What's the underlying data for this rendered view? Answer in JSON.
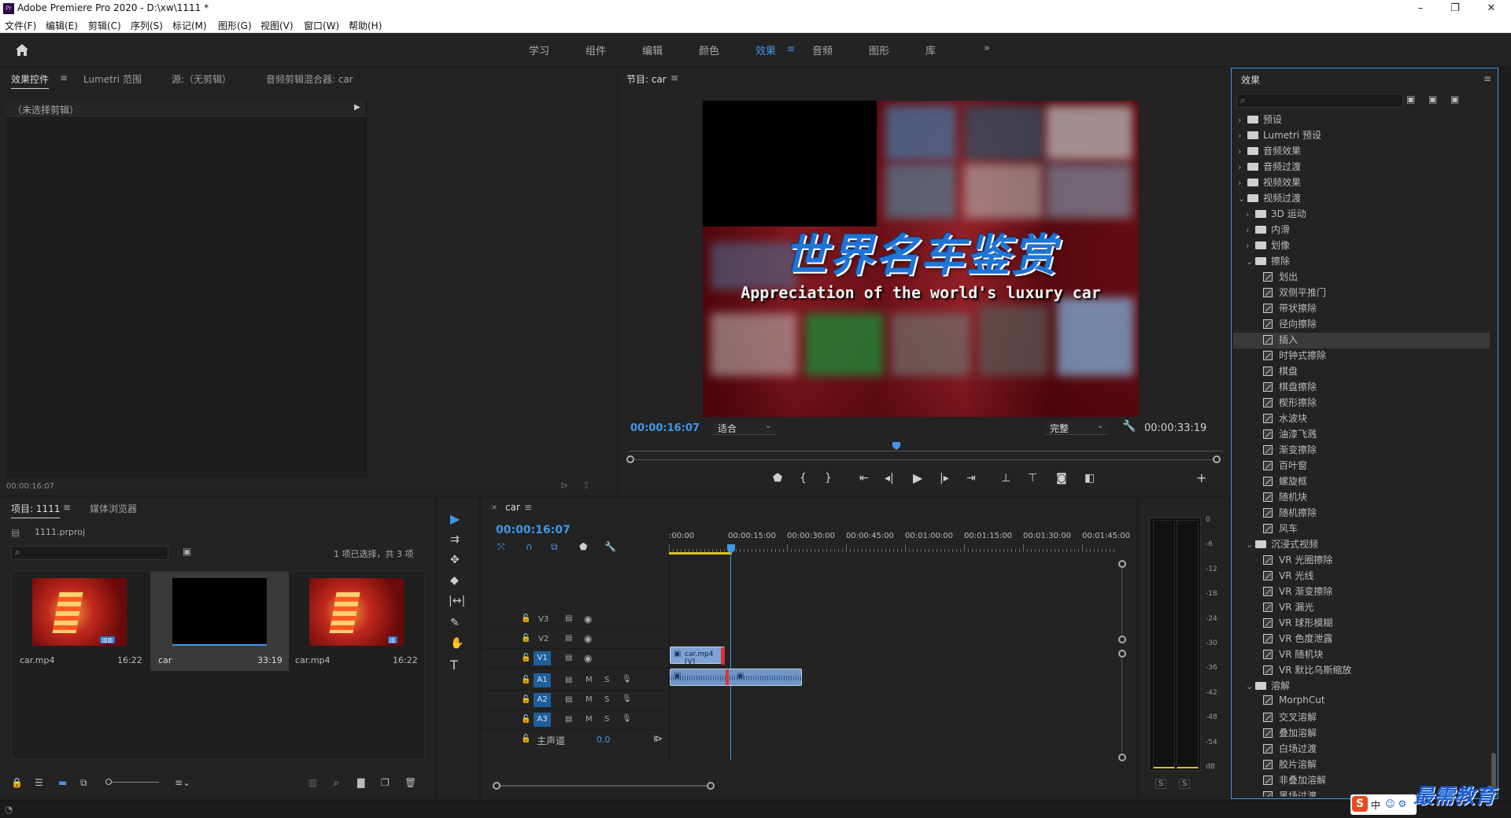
{
  "titlebar": {
    "title": "Adobe Premiere Pro 2020 - D:\\xw\\1111 *",
    "minimize": "–",
    "maximize": "❐",
    "close": "✕",
    "logo": "Pr"
  },
  "menubar": [
    "文件(F)",
    "编辑(E)",
    "剪辑(C)",
    "序列(S)",
    "标记(M)",
    "图形(G)",
    "视图(V)",
    "窗口(W)",
    "帮助(H)"
  ],
  "workspaces": {
    "items": [
      "学习",
      "组件",
      "编辑",
      "颜色",
      "效果",
      "音频",
      "图形",
      "库"
    ],
    "active": "效果",
    "more": "»"
  },
  "source_panel": {
    "tabs": [
      "效果控件",
      "Lumetri 范围",
      "源:（无剪辑）",
      "音频剪辑混合器: car"
    ],
    "active_tab": "效果控件",
    "no_clip": "（未选择剪辑）",
    "timecode": "00:00:16:07"
  },
  "program_monitor": {
    "tab": "节目: car",
    "title_cn": "世界名车鉴赏",
    "title_en": "Appreciation of the world's luxury car",
    "timecode_current": "00:00:16:07",
    "fit_label": "适合",
    "quality_label": "完整",
    "timecode_total": "00:00:33:19"
  },
  "project_panel": {
    "tabs": [
      "项目: 1111",
      "媒体浏览器"
    ],
    "project_file": "1111.prproj",
    "selection_info": "1 项已选择，共 3 项",
    "items": [
      {
        "name": "car.mp4",
        "duration": "16:22",
        "kind": "video"
      },
      {
        "name": "car",
        "duration": "33:19",
        "kind": "sequence"
      },
      {
        "name": "car.mp4",
        "duration": "16:22",
        "kind": "video"
      }
    ]
  },
  "timeline": {
    "sequence_name": "car",
    "timecode": "00:00:16:07",
    "ruler": [
      ":00:00",
      "00:00:15:00",
      "00:00:30:00",
      "00:00:45:00",
      "00:01:00:00",
      "00:01:15:00",
      "00:01:30:00",
      "00:01:45:00"
    ],
    "video_tracks": [
      "V3",
      "V2",
      "V1"
    ],
    "audio_tracks": [
      "A3",
      "A2",
      "A1"
    ],
    "master_label": "主声道",
    "master_value": "0.0",
    "clip_label": "car.mp4 [V]",
    "mute_label": "M",
    "solo_label": "S"
  },
  "meter": {
    "ticks": [
      "0",
      "-6",
      "-12",
      "-18",
      "-24",
      "-30",
      "-36",
      "-42",
      "-48",
      "-54",
      "dB"
    ],
    "solo_left": "S",
    "solo_right": "S"
  },
  "effects_panel": {
    "title": "效果",
    "tree": [
      {
        "label": "预设",
        "level": 0,
        "type": "folder",
        "open": false
      },
      {
        "label": "Lumetri 预设",
        "level": 0,
        "type": "folder",
        "open": false
      },
      {
        "label": "音频效果",
        "level": 0,
        "type": "folder",
        "open": false
      },
      {
        "label": "音频过渡",
        "level": 0,
        "type": "folder",
        "open": false
      },
      {
        "label": "视频效果",
        "level": 0,
        "type": "folder",
        "open": false
      },
      {
        "label": "视频过渡",
        "level": 0,
        "type": "folder",
        "open": true
      },
      {
        "label": "3D 运动",
        "level": 1,
        "type": "folder",
        "open": false
      },
      {
        "label": "内滑",
        "level": 1,
        "type": "folder",
        "open": false
      },
      {
        "label": "划像",
        "level": 1,
        "type": "folder",
        "open": false
      },
      {
        "label": "擦除",
        "level": 1,
        "type": "folder",
        "open": true
      },
      {
        "label": "划出",
        "level": 2,
        "type": "effect"
      },
      {
        "label": "双侧平推门",
        "level": 2,
        "type": "effect"
      },
      {
        "label": "带状擦除",
        "level": 2,
        "type": "effect"
      },
      {
        "label": "径向擦除",
        "level": 2,
        "type": "effect"
      },
      {
        "label": "插入",
        "level": 2,
        "type": "effect",
        "selected": true
      },
      {
        "label": "时钟式擦除",
        "level": 2,
        "type": "effect"
      },
      {
        "label": "棋盘",
        "level": 2,
        "type": "effect"
      },
      {
        "label": "棋盘擦除",
        "level": 2,
        "type": "effect"
      },
      {
        "label": "楔形擦除",
        "level": 2,
        "type": "effect"
      },
      {
        "label": "水波块",
        "level": 2,
        "type": "effect"
      },
      {
        "label": "油漆飞溅",
        "level": 2,
        "type": "effect"
      },
      {
        "label": "渐变擦除",
        "level": 2,
        "type": "effect"
      },
      {
        "label": "百叶窗",
        "level": 2,
        "type": "effect"
      },
      {
        "label": "螺旋框",
        "level": 2,
        "type": "effect"
      },
      {
        "label": "随机块",
        "level": 2,
        "type": "effect"
      },
      {
        "label": "随机擦除",
        "level": 2,
        "type": "effect"
      },
      {
        "label": "风车",
        "level": 2,
        "type": "effect"
      },
      {
        "label": "沉浸式视频",
        "level": 1,
        "type": "folder",
        "open": true
      },
      {
        "label": "VR 光圈擦除",
        "level": 2,
        "type": "effect"
      },
      {
        "label": "VR 光线",
        "level": 2,
        "type": "effect"
      },
      {
        "label": "VR 渐变擦除",
        "level": 2,
        "type": "effect"
      },
      {
        "label": "VR 漏光",
        "level": 2,
        "type": "effect"
      },
      {
        "label": "VR 球形模糊",
        "level": 2,
        "type": "effect"
      },
      {
        "label": "VR 色度泄露",
        "level": 2,
        "type": "effect"
      },
      {
        "label": "VR 随机块",
        "level": 2,
        "type": "effect"
      },
      {
        "label": "VR 默比乌斯缩放",
        "level": 2,
        "type": "effect"
      },
      {
        "label": "溶解",
        "level": 1,
        "type": "folder",
        "open": true
      },
      {
        "label": "MorphCut",
        "level": 2,
        "type": "effect"
      },
      {
        "label": "交叉溶解",
        "level": 2,
        "type": "effect"
      },
      {
        "label": "叠加溶解",
        "level": 2,
        "type": "effect"
      },
      {
        "label": "白场过渡",
        "level": 2,
        "type": "effect"
      },
      {
        "label": "胶片溶解",
        "level": 2,
        "type": "effect"
      },
      {
        "label": "非叠加溶解",
        "level": 2,
        "type": "effect"
      },
      {
        "label": "黑场过渡",
        "level": 2,
        "type": "effect"
      }
    ]
  },
  "watermark": "最需教育",
  "ime": "中",
  "colors": {
    "accent": "#3f97e8",
    "panel": "#232323",
    "clip_video": "#7fa3d6",
    "clip_audio": "#6f95c9",
    "playhead": "#3f97e8"
  }
}
